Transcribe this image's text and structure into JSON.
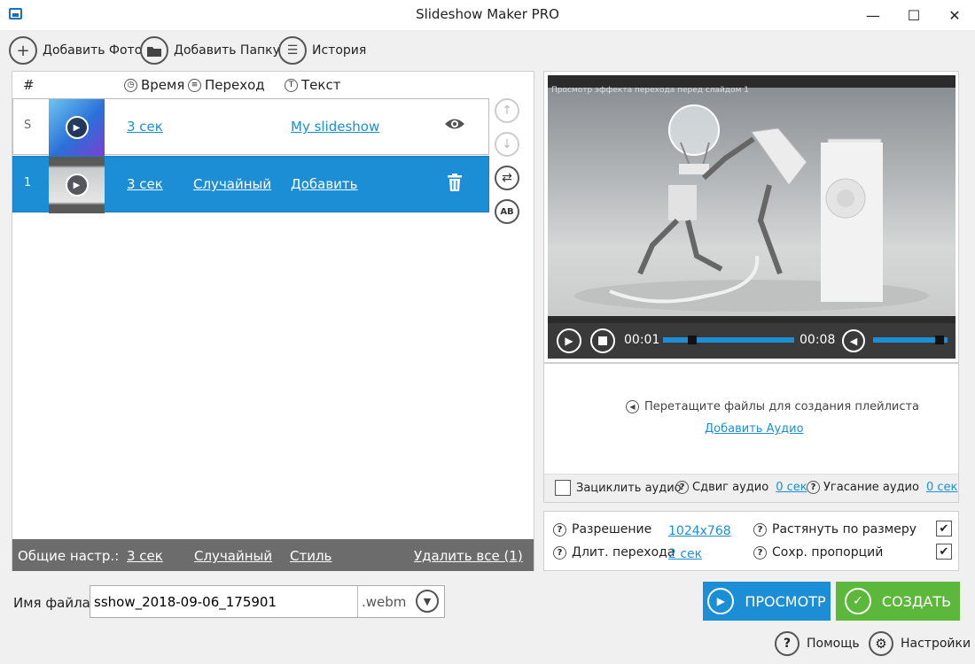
{
  "window": {
    "title": "Slideshow Maker PRO"
  },
  "toolbar": {
    "add_photo": "Добавить Фото",
    "add_folder": "Добавить Папку",
    "history": "История"
  },
  "slides": {
    "headers": {
      "num": "#",
      "time": "Время",
      "transition": "Переход",
      "text": "Текст"
    },
    "rows": [
      {
        "num": "S",
        "time": "3 сек",
        "transition": "",
        "text": "My slideshow"
      },
      {
        "num": "1",
        "time": "3 сек",
        "transition": "Случайный",
        "text": "Добавить"
      }
    ],
    "bulk": {
      "label": "Общие настр.:",
      "time": "3 сек",
      "transition": "Случайный",
      "style": "Стиль",
      "delete_all": "Удалить все (1)"
    }
  },
  "preview": {
    "overlay": "Просмотр эффекта перехода перед слайдом 1",
    "current_time": "00:01",
    "total_time": "00:08",
    "progress": 0.2,
    "volume": 0.95
  },
  "audio": {
    "drop_hint": "Перетащите файлы для создания плейлиста",
    "add_audio": "Добавить Аудио",
    "loop_label": "Зациклить аудио",
    "loop_checked": false,
    "shift_label": "Сдвиг аудио",
    "shift_value": "0 сек",
    "fade_label": "Угасание аудио",
    "fade_value": "0 сек"
  },
  "settings": {
    "resolution_label": "Разрешение",
    "resolution_value": "1024x768",
    "duration_label": "Длит. перехода",
    "duration_value": "2 сек",
    "stretch_label": "Растянуть по размеру",
    "stretch_checked": true,
    "keep_ratio_label": "Сохр. пропорций",
    "keep_ratio_checked": true
  },
  "file": {
    "label": "Имя файла:",
    "name": "sshow_2018-09-06_175901",
    "extension": ".webm"
  },
  "actions": {
    "preview": "ПРОСМОТР",
    "create": "СОЗДАТЬ"
  },
  "footer": {
    "help": "Помощь",
    "settings": "Настройки"
  },
  "colors": {
    "accent": "#1b8ed6",
    "create": "#5cb83a",
    "bulk_bar": "#6c6c6c"
  }
}
